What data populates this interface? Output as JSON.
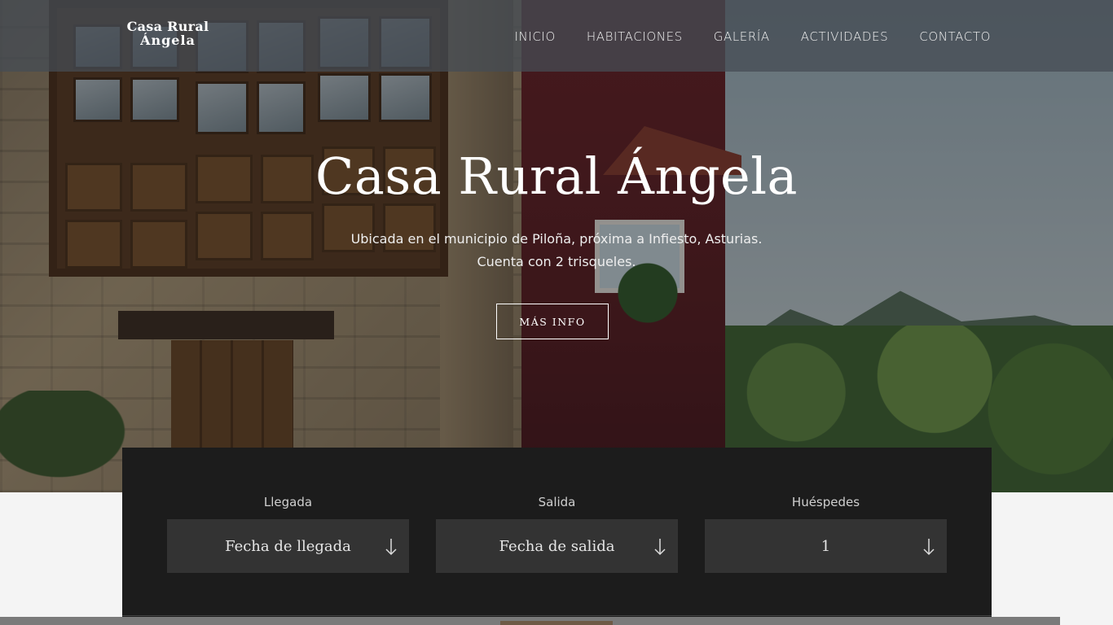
{
  "brand": {
    "logo_line1": "Casa Rural",
    "logo_line2": "Ángela"
  },
  "nav": {
    "items": [
      {
        "label": "INICIO"
      },
      {
        "label": "HABITACIONES"
      },
      {
        "label": "GALERÍA"
      },
      {
        "label": "ACTIVIDADES"
      },
      {
        "label": "CONTACTO"
      }
    ]
  },
  "hero": {
    "title": "Casa Rural Ángela",
    "subtitle_line1": "Ubicada en el municipio de Piloña, próxima a Infiesto, Asturias.",
    "subtitle_line2": "Cuenta con 2 trisqueles.",
    "button_label": "MÁS INFO"
  },
  "booking": {
    "arrival": {
      "label": "Llegada",
      "value": "Fecha de llegada"
    },
    "departure": {
      "label": "Salida",
      "value": "Fecha de salida"
    },
    "guests": {
      "label": "Huéspedes",
      "value": "1"
    }
  },
  "icons": {
    "dropdown": "arrow-down-icon"
  },
  "colors": {
    "booking_bg": "#1c1c1c",
    "field_bg": "#333333",
    "nav_bg": "#464c54"
  }
}
